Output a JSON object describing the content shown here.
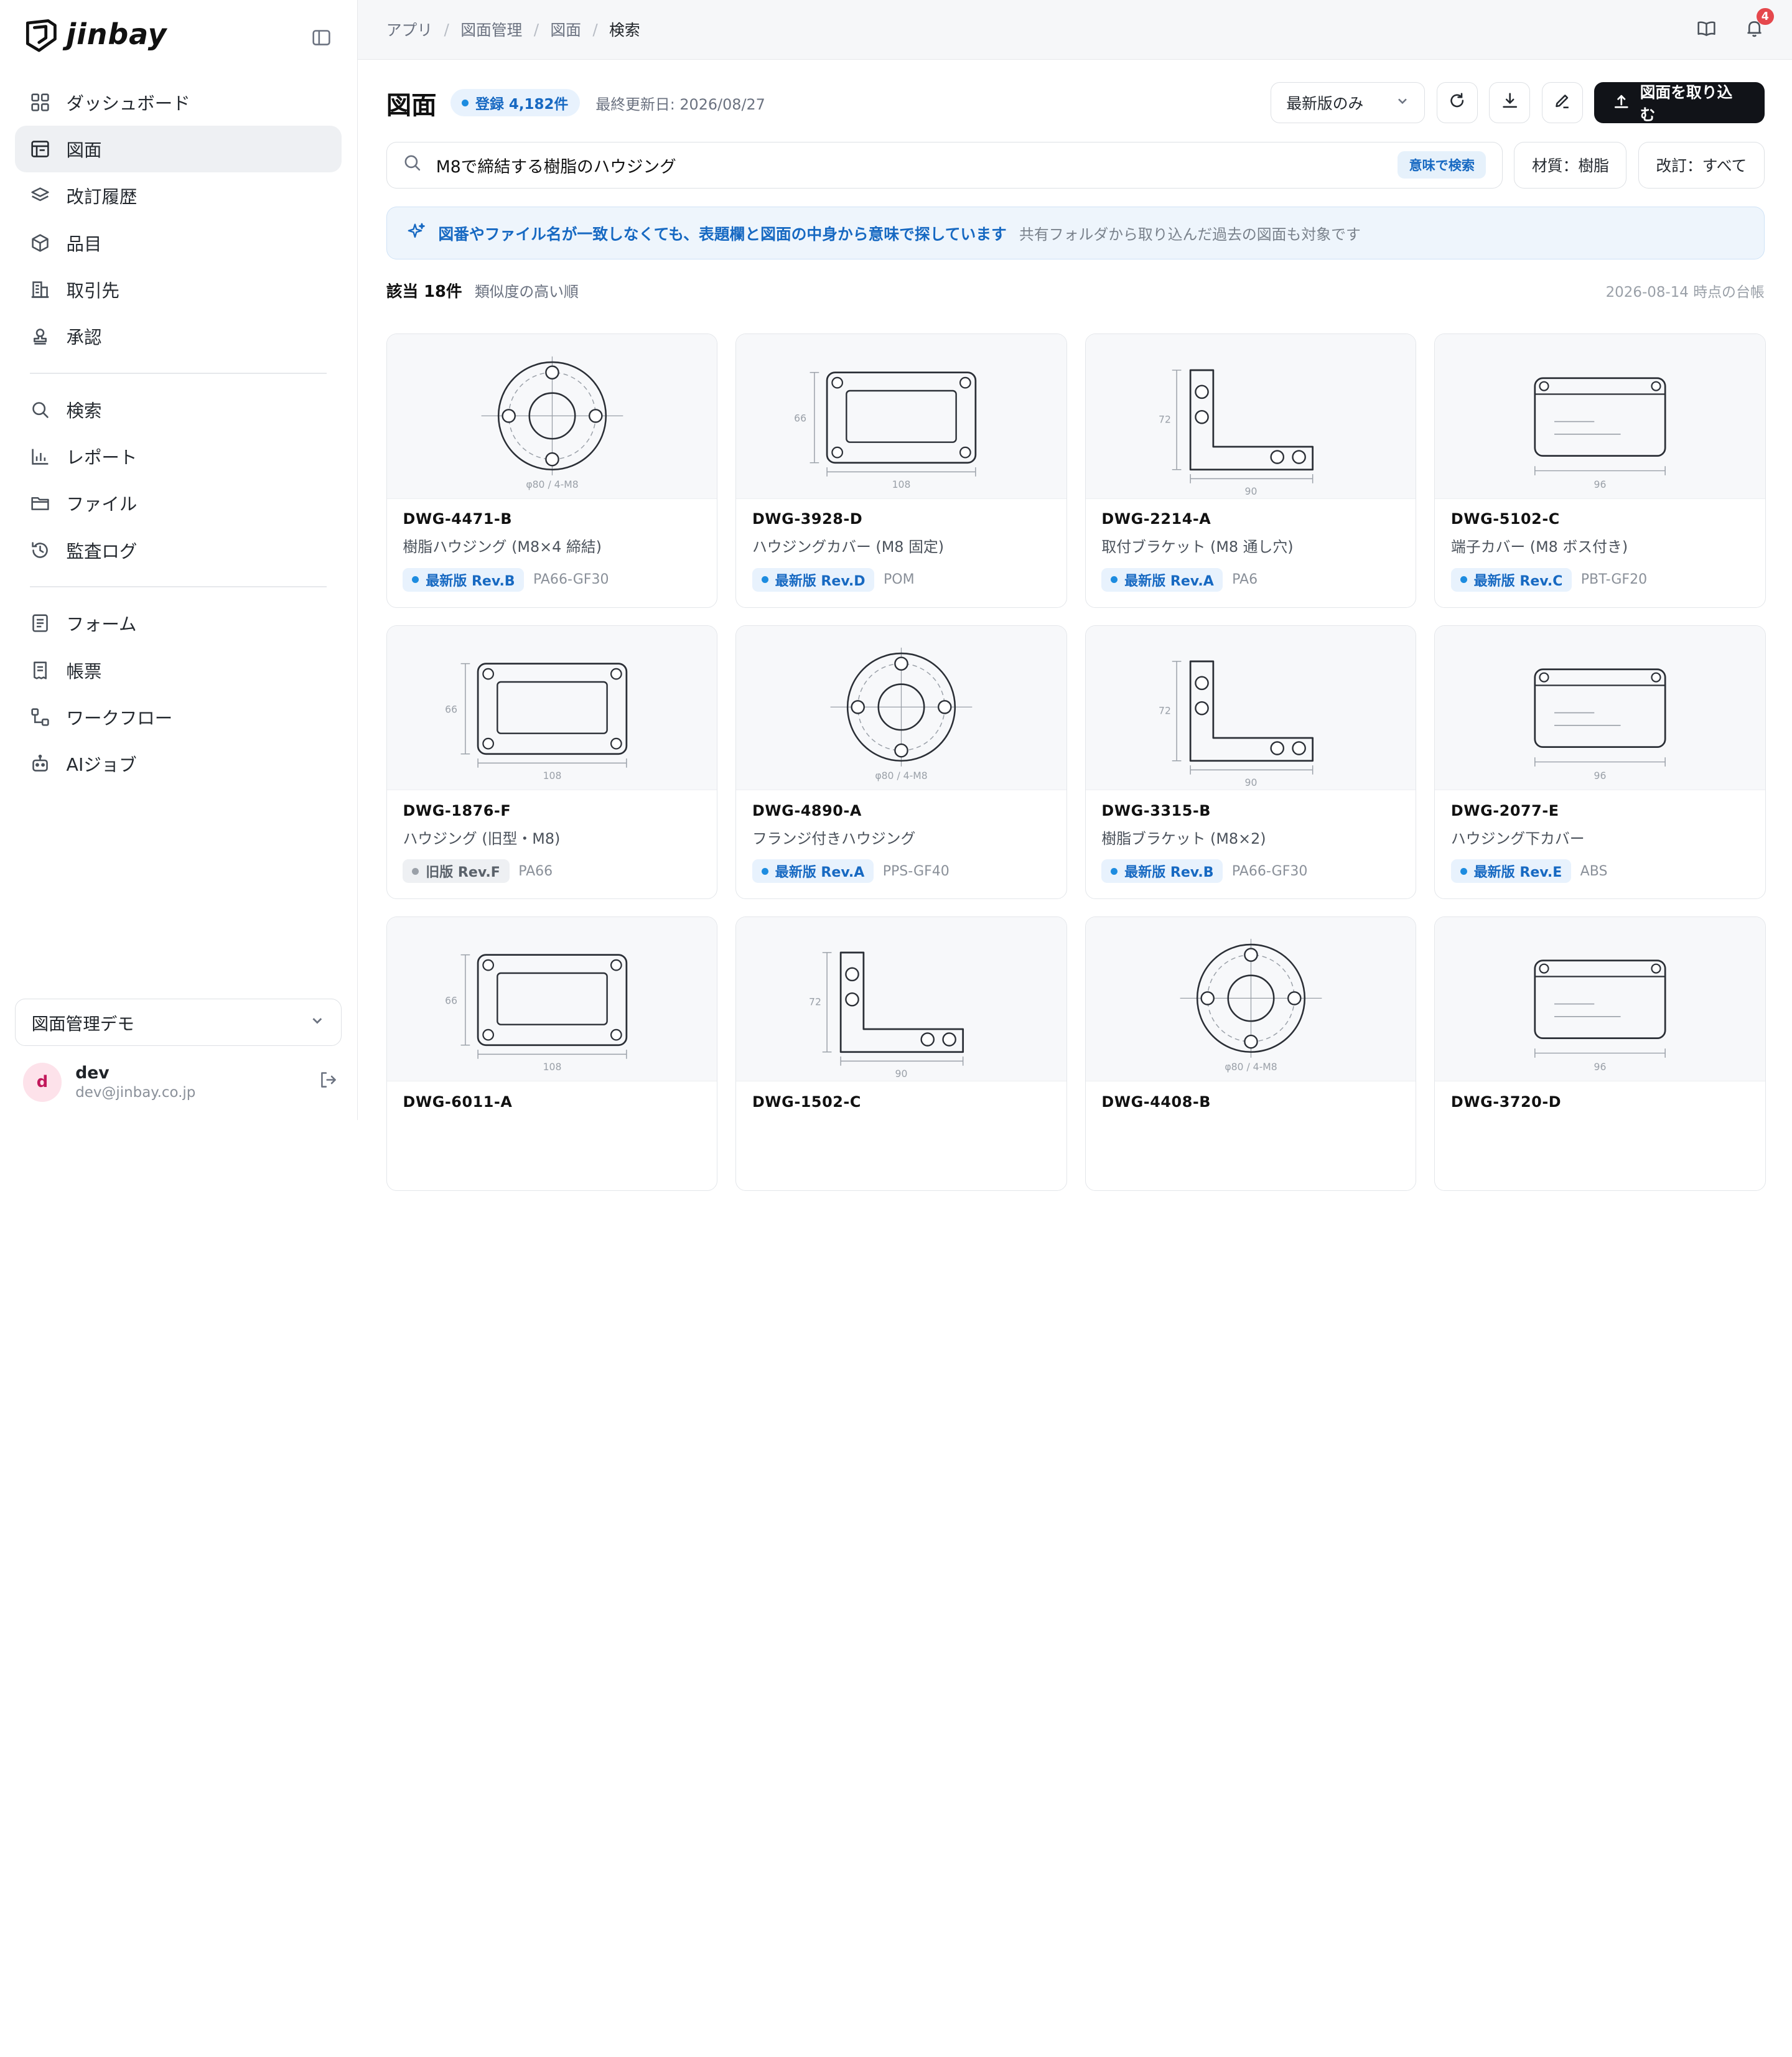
{
  "brand": {
    "name": "jinbay"
  },
  "sidebar": {
    "groups": [
      [
        {
          "label": "ダッシュボード",
          "icon": "grid-icon"
        },
        {
          "label": "図面",
          "icon": "drawing-table-icon",
          "active": true
        },
        {
          "label": "改訂履歴",
          "icon": "layers-icon"
        },
        {
          "label": "品目",
          "icon": "box-icon"
        },
        {
          "label": "取引先",
          "icon": "building-icon"
        },
        {
          "label": "承認",
          "icon": "stamp-icon"
        }
      ],
      [
        {
          "label": "検索",
          "icon": "search-icon"
        },
        {
          "label": "レポート",
          "icon": "bar-chart-icon"
        },
        {
          "label": "ファイル",
          "icon": "folder-icon"
        },
        {
          "label": "監査ログ",
          "icon": "history-icon"
        }
      ],
      [
        {
          "label": "フォーム",
          "icon": "form-icon"
        },
        {
          "label": "帳票",
          "icon": "receipt-icon"
        },
        {
          "label": "ワークフロー",
          "icon": "workflow-icon"
        },
        {
          "label": "AIジョブ",
          "icon": "robot-icon"
        }
      ]
    ],
    "workspace": "図面管理デモ",
    "user": {
      "initial": "d",
      "name": "dev",
      "email": "dev@jinbay.co.jp"
    }
  },
  "topbar": {
    "breadcrumb": [
      "アプリ",
      "図面管理",
      "図面",
      "検索"
    ],
    "notification_count": "4"
  },
  "header": {
    "title": "図面",
    "count_badge": "登録 4,182件",
    "updated": "最終更新日: 2026/08/27",
    "version_filter": "最新版のみ",
    "import_button": "図面を取り込む"
  },
  "search": {
    "query": "M8で締結する樹脂のハウジング",
    "semantic_tag": "意味で検索",
    "filters": [
      "材質：樹脂",
      "改訂：すべて"
    ]
  },
  "banner": {
    "strong": "図番やファイル名が一致しなくても、表題欄と図面の中身から意味で探しています",
    "sub": "共有フォルダから取り込んだ過去の図面も対象です"
  },
  "results": {
    "count": "該当 18件",
    "sort": "類似度の高い順",
    "snapshot": "2026-08-14 時点の台帳"
  },
  "cards": [
    {
      "id": "DWG-4471-B",
      "name": "樹脂ハウジング (M8×4 締結)",
      "rev": "最新版 Rev.B",
      "status": "latest",
      "material": "PA66-GF30",
      "shape": "flange",
      "dim": "φ80 / 4-M8"
    },
    {
      "id": "DWG-3928-D",
      "name": "ハウジングカバー (M8 固定)",
      "rev": "最新版 Rev.D",
      "status": "latest",
      "material": "POM",
      "shape": "plate",
      "dim_w": "108",
      "dim_h": "66"
    },
    {
      "id": "DWG-2214-A",
      "name": "取付ブラケット (M8 通し穴)",
      "rev": "最新版 Rev.A",
      "status": "latest",
      "material": "PA6",
      "shape": "bracket",
      "dim_w": "90",
      "dim_h": "72"
    },
    {
      "id": "DWG-5102-C",
      "name": "端子カバー (M8 ボス付き)",
      "rev": "最新版 Rev.C",
      "status": "latest",
      "material": "PBT-GF20",
      "shape": "cover",
      "dim_w": "96"
    },
    {
      "id": "DWG-1876-F",
      "name": "ハウジング (旧型・M8)",
      "rev": "旧版 Rev.F",
      "status": "old",
      "material": "PA66",
      "shape": "plate",
      "dim_w": "108",
      "dim_h": "66"
    },
    {
      "id": "DWG-4890-A",
      "name": "フランジ付きハウジング",
      "rev": "最新版 Rev.A",
      "status": "latest",
      "material": "PPS-GF40",
      "shape": "flange",
      "dim": "φ80 / 4-M8"
    },
    {
      "id": "DWG-3315-B",
      "name": "樹脂ブラケット (M8×2)",
      "rev": "最新版 Rev.B",
      "status": "latest",
      "material": "PA66-GF30",
      "shape": "bracket",
      "dim_w": "90",
      "dim_h": "72"
    },
    {
      "id": "DWG-2077-E",
      "name": "ハウジング下カバー",
      "rev": "最新版 Rev.E",
      "status": "latest",
      "material": "ABS",
      "shape": "cover",
      "dim_w": "96"
    },
    {
      "id": "DWG-6011-A",
      "name": "",
      "rev": "",
      "status": "",
      "material": "",
      "shape": "plate",
      "dim_w": "108",
      "dim_h": "66"
    },
    {
      "id": "DWG-1502-C",
      "name": "",
      "rev": "",
      "status": "",
      "material": "",
      "shape": "bracket",
      "dim_w": "90",
      "dim_h": "72"
    },
    {
      "id": "DWG-4408-B",
      "name": "",
      "rev": "",
      "status": "",
      "material": "",
      "shape": "flange",
      "dim": "φ80 / 4-M8"
    },
    {
      "id": "DWG-3720-D",
      "name": "",
      "rev": "",
      "status": "",
      "material": "",
      "shape": "cover",
      "dim_w": "96"
    }
  ]
}
